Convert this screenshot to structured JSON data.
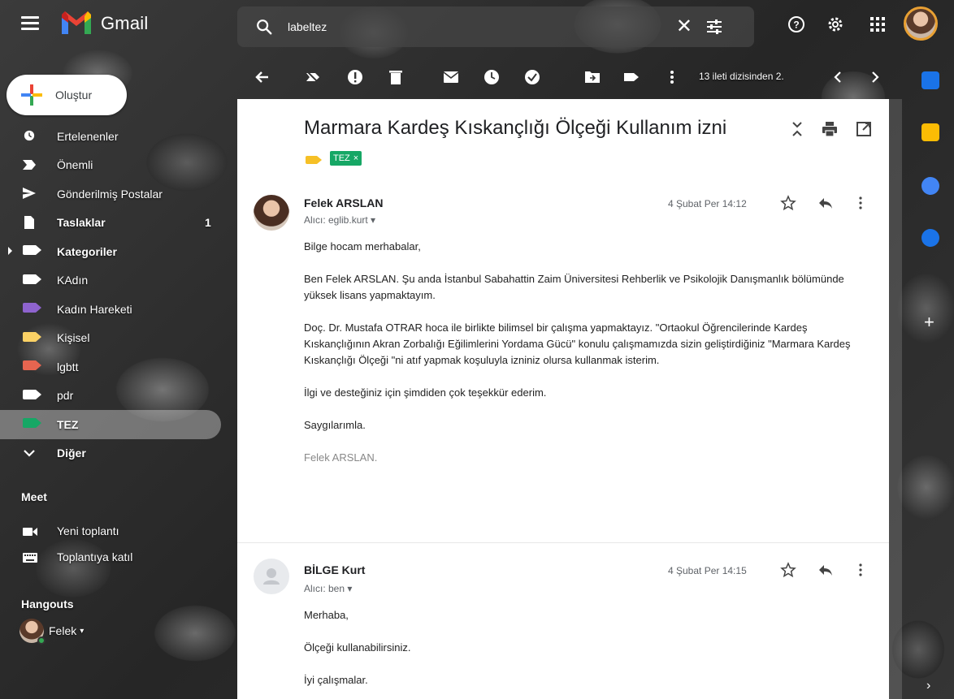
{
  "app": {
    "name": "Gmail"
  },
  "search": {
    "value": "labeltez"
  },
  "compose": {
    "label": "Oluştur"
  },
  "sidebar": {
    "items": [
      {
        "label": "Ertelenenler",
        "icon": "clock-icon"
      },
      {
        "label": "Önemli",
        "icon": "important-icon"
      },
      {
        "label": "Gönderilmiş Postalar",
        "icon": "send-icon"
      },
      {
        "label": "Taslaklar",
        "icon": "draft-icon",
        "count": "1",
        "bold": true
      },
      {
        "label": "Kategoriler",
        "icon": "label-icon",
        "bold": true,
        "expandable": true
      },
      {
        "label": "KAdın",
        "icon": "label-icon",
        "color": "#ffffff"
      },
      {
        "label": "Kadın Hareketi",
        "icon": "label-icon",
        "color": "#8e63ce"
      },
      {
        "label": "Kişisel",
        "icon": "label-icon",
        "color": "#fad165"
      },
      {
        "label": "lgbtt",
        "icon": "label-icon",
        "color": "#e66550"
      },
      {
        "label": "pdr",
        "icon": "label-icon",
        "color": "#ffffff"
      },
      {
        "label": "TEZ",
        "icon": "label-icon",
        "color": "#16a765",
        "bold": true,
        "active": true
      },
      {
        "label": "Diğer",
        "icon": "chevron-down-icon"
      }
    ],
    "meet": {
      "title": "Meet",
      "items": [
        {
          "label": "Yeni toplantı",
          "icon": "video-icon"
        },
        {
          "label": "Toplantıya katıl",
          "icon": "keyboard-icon"
        }
      ]
    },
    "hangouts": {
      "title": "Hangouts",
      "user": "Felek"
    }
  },
  "toolbar": {
    "pagination": "13 ileti dizisinden 2."
  },
  "thread": {
    "subject": "Marmara Kardeş Kıskançlığı Ölçeği Kullanım izni",
    "label_chip": "TEZ",
    "label_chip_close": "×",
    "messages": [
      {
        "sender": "Felek ARSLAN",
        "to": "Alıcı: eglib.kurt",
        "date": "4 Şubat Per 14:12",
        "body": [
          "Bilge hocam merhabalar,",
          "Ben Felek ARSLAN. Şu anda İstanbul Sabahattin Zaim Üniversitesi Rehberlik ve Psikolojik Danışmanlık bölümünde yüksek lisans yapmaktayım.",
          "Doç. Dr.  Mustafa OTRAR hoca  ile birlikte bilimsel bir çalışma yapmaktayız. \"Ortaokul Öğrencilerinde Kardeş Kıskançlığının Akran Zorbalığı Eğilimlerini Yordama Gücü\" konulu çalışmamızda  sizin geliştirdiğiniz \"Marmara Kardeş Kıskançlığı Ölçeği \"ni atıf yapmak koşuluyla izniniz olursa kullanmak isterim.",
          "İlgi ve desteğiniz için şimdiden çok teşekkür ederim.",
          "Saygılarımla."
        ],
        "signature": "Felek ARSLAN."
      },
      {
        "sender": "BİLGE Kurt",
        "to": "Alıcı: ben",
        "date": "4 Şubat Per 14:15",
        "body": [
          "Merhaba,",
          "Ölçeği kullanabilirsiniz.",
          "İyi çalışmalar."
        ]
      }
    ]
  },
  "colors": {
    "label_green": "#16a765",
    "importance_yellow": "#f6c026",
    "avatar_ring": "#e8a033"
  }
}
